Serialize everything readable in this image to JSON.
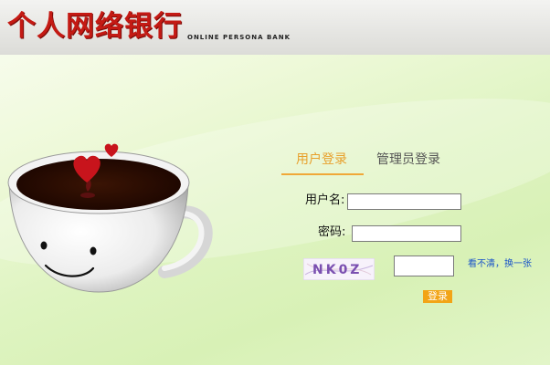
{
  "header": {
    "title": "个人网络银行",
    "subtitle": "ONLINE PERSONA BANK"
  },
  "tabs": [
    {
      "label": "用户登录",
      "active": true
    },
    {
      "label": "管理员登录",
      "active": false
    }
  ],
  "form": {
    "username_label": "用户名:",
    "username_value": "",
    "password_label": "密码:",
    "password_value": "",
    "captcha_value": "",
    "captcha_text": "NK0Z",
    "refresh_link": "看不清，换一张",
    "login_button": "登录"
  },
  "icons": {
    "cup": "coffee-cup-illustration",
    "hearts": "heart-icon"
  },
  "colors": {
    "title_red": "#c41a14",
    "tab_active": "#e8a02c",
    "button_orange": "#f2a416",
    "link_blue": "#1a55c8"
  }
}
